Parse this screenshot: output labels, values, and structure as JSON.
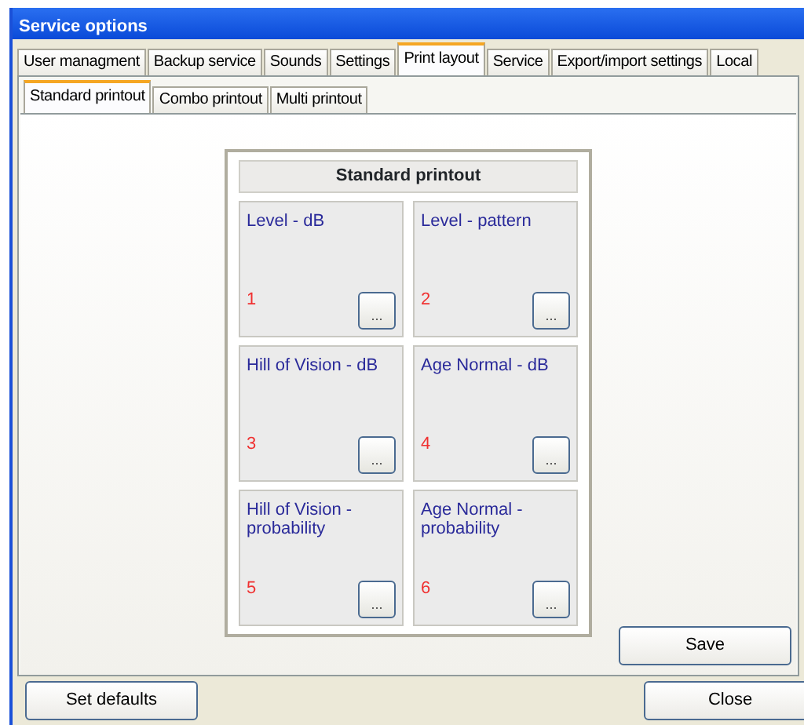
{
  "window": {
    "title": "Service options"
  },
  "tabs": [
    {
      "label": "User managment",
      "selected": false
    },
    {
      "label": "Backup service",
      "selected": false
    },
    {
      "label": "Sounds",
      "selected": false
    },
    {
      "label": "Settings",
      "selected": false
    },
    {
      "label": "Print layout",
      "selected": true
    },
    {
      "label": "Service",
      "selected": false
    },
    {
      "label": "Export/import settings",
      "selected": false
    },
    {
      "label": "Local",
      "selected": false
    }
  ],
  "subtabs": [
    {
      "label": "Standard printout",
      "selected": true
    },
    {
      "label": "Combo printout",
      "selected": false
    },
    {
      "label": "Multi printout",
      "selected": false
    }
  ],
  "layout_panel": {
    "title": "Standard printout",
    "slots": [
      {
        "title": "Level - dB",
        "number": "1",
        "button": "..."
      },
      {
        "title": "Level - pattern",
        "number": "2",
        "button": "..."
      },
      {
        "title": "Hill of Vision - dB",
        "number": "3",
        "button": "..."
      },
      {
        "title": "Age Normal - dB",
        "number": "4",
        "button": "..."
      },
      {
        "title": "Hill of Vision - probability",
        "number": "5",
        "button": "..."
      },
      {
        "title": "Age Normal - probability",
        "number": "6",
        "button": "..."
      }
    ]
  },
  "save_button": "Save",
  "footer_buttons": [
    "Set defaults",
    "Close"
  ]
}
